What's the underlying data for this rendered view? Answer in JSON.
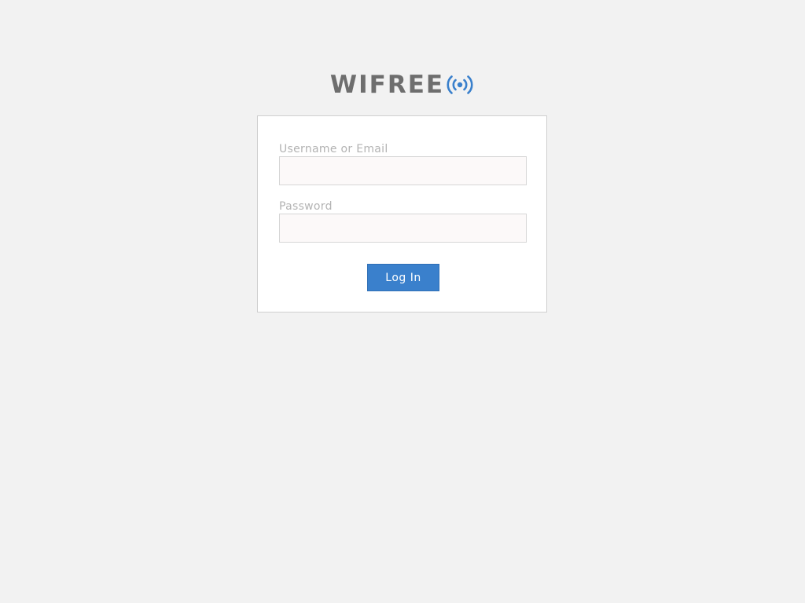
{
  "logo": {
    "text": "WIFREE",
    "icon": "wifi-broadcast-icon",
    "icon_color": "#3a80cc",
    "text_color": "#6e6e6e"
  },
  "login_form": {
    "username_label": "Username or Email",
    "username_value": "",
    "username_placeholder": "",
    "password_label": "Password",
    "password_value": "",
    "password_placeholder": "",
    "submit_label": "Log In"
  },
  "colors": {
    "background": "#f2f2f2",
    "card": "#ffffff",
    "accent": "#3a80cc"
  }
}
